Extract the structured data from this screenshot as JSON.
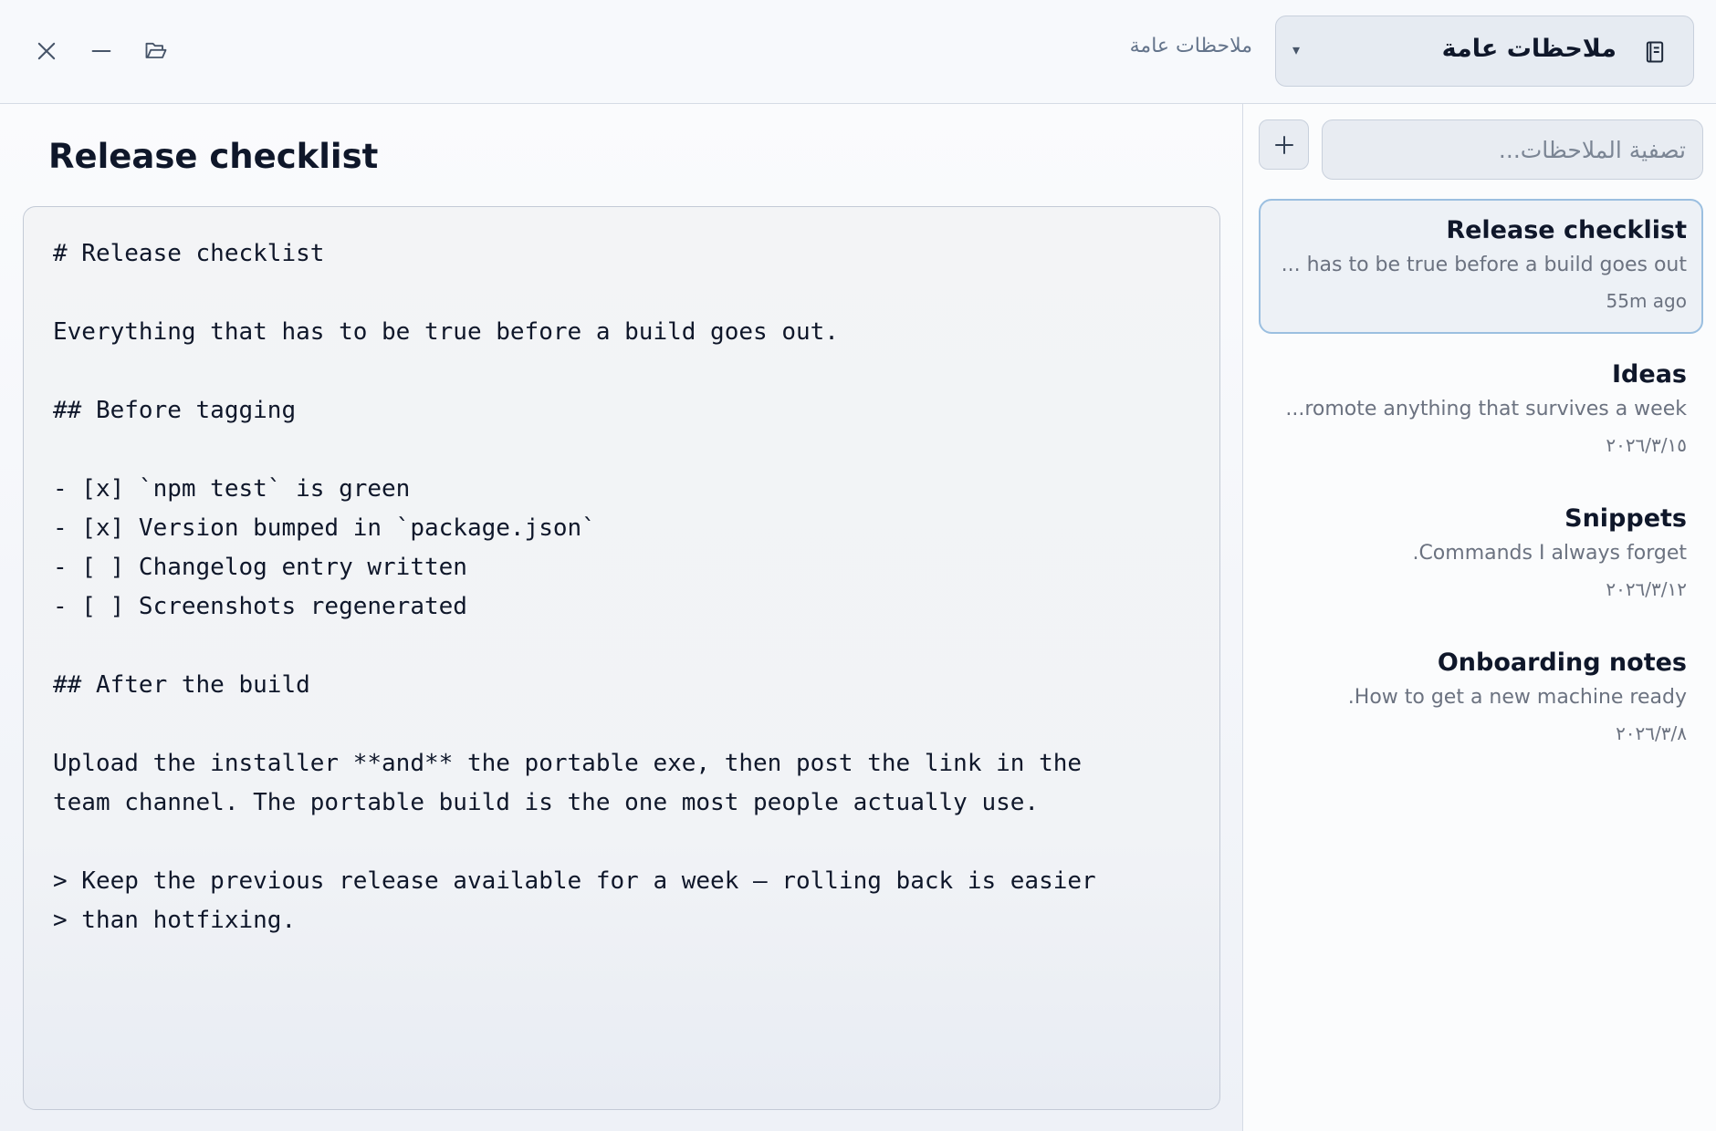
{
  "header": {
    "notebook_label": "ملاحظات عامة",
    "notebook_select": {
      "value": "ملاحظات عامة",
      "caret": "▾"
    },
    "controls": [
      "close-icon",
      "minimize-icon",
      "folder-open-icon"
    ]
  },
  "editor": {
    "title": "Release checklist",
    "content": "# Release checklist\n\nEverything that has to be true before a build goes out.\n\n## Before tagging\n\n- [x] `npm test` is green\n- [x] Version bumped in `package.json`\n- [ ] Changelog entry written\n- [ ] Screenshots regenerated\n\n## After the build\n\nUpload the installer **and** the portable exe, then post the link in the\nteam channel. The portable build is the one most people actually use.\n\n> Keep the previous release available for a week — rolling back is easier\n> than hotfixing."
  },
  "sidebar": {
    "filter_placeholder": "تصفية الملاحظات...",
    "add_icon": "plus-icon",
    "notes": [
      {
        "title": "Release checklist",
        "preview": "... has to be true before a build goes out",
        "date": "55m ago",
        "active": true
      },
      {
        "title": "Ideas",
        "preview": "...romote anything that survives a week",
        "date": "٢٠٢٦/٣/١٥",
        "active": false
      },
      {
        "title": "Snippets",
        "preview": ".Commands I always forget",
        "date": "٢٠٢٦/٣/١٢",
        "active": false
      },
      {
        "title": "Onboarding notes",
        "preview": ".How to get a new machine ready",
        "date": "٢٠٢٦/٣/٨",
        "active": false
      }
    ]
  },
  "colors": {
    "accent_border": "#9bbfe0",
    "text_primary": "#0f172a",
    "text_muted": "#6b7280"
  }
}
